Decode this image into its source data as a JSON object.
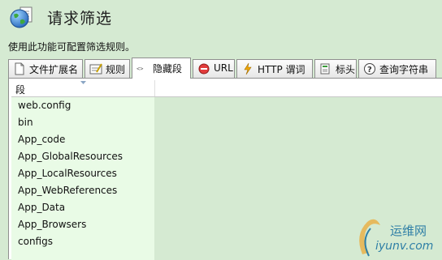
{
  "header": {
    "title": "请求筛选",
    "description": "使用此功能可配置筛选规则。"
  },
  "tabs": [
    {
      "label": "文件扩展名",
      "icon": "page-icon"
    },
    {
      "label": "规则",
      "icon": "document-edit-icon"
    },
    {
      "label": "隐藏段",
      "icon": "hidden-segment-icon",
      "active": true
    },
    {
      "label": "URL",
      "icon": "url-deny-icon"
    },
    {
      "label": "HTTP 谓词",
      "icon": "lightning-icon"
    },
    {
      "label": "标头",
      "icon": "headers-icon"
    },
    {
      "label": "查询字符串",
      "icon": "help-circle-icon"
    }
  ],
  "grid": {
    "column_header": "段",
    "rows": [
      "web.config",
      "bin",
      "App_code",
      "App_GlobalResources",
      "App_LocalResources",
      "App_WebReferences",
      "App_Data",
      "App_Browsers",
      "configs"
    ]
  },
  "watermark": {
    "name": "运维网",
    "url": "iyunv.com"
  }
}
